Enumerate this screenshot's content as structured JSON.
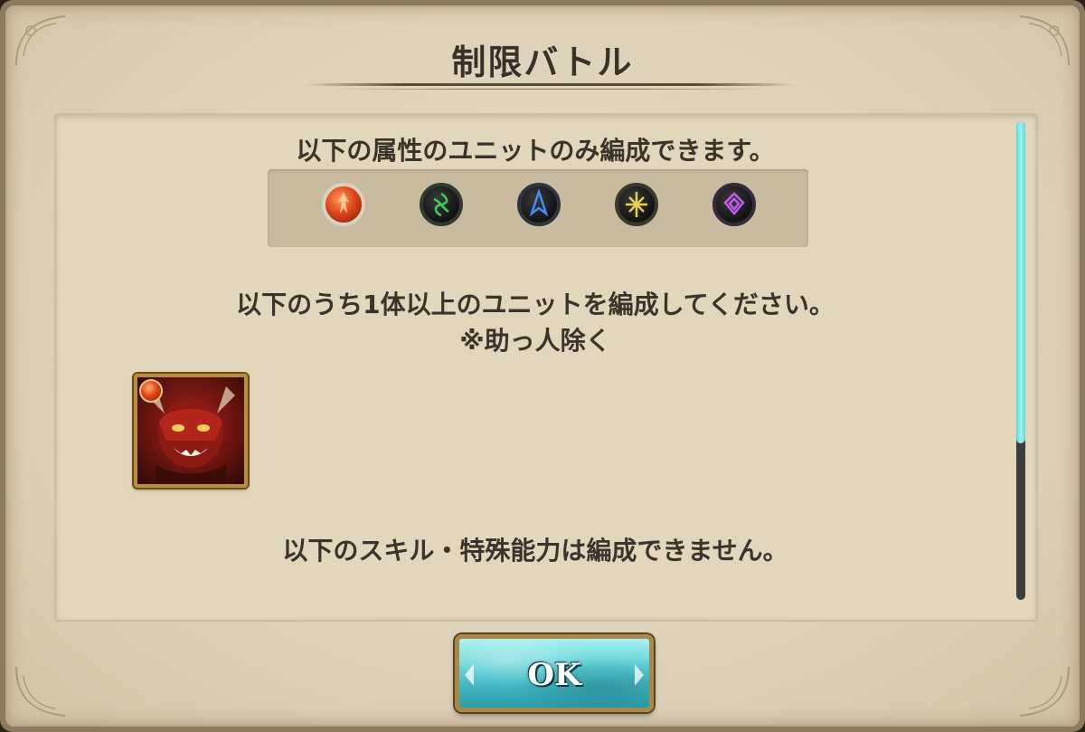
{
  "dialog": {
    "title": "制限バトル",
    "attribute_restriction_text": "以下の属性のユニットのみ編成できます。",
    "attributes": [
      {
        "name": "fire",
        "color": "#e0461a",
        "icon": "fire-attribute-icon"
      },
      {
        "name": "wind",
        "color": "#2a8a3a",
        "icon": "wind-attribute-icon"
      },
      {
        "name": "water",
        "color": "#2f6fd0",
        "icon": "water-attribute-icon"
      },
      {
        "name": "light",
        "color": "#c9b43a",
        "icon": "light-attribute-icon"
      },
      {
        "name": "dark",
        "color": "#8a36b8",
        "icon": "dark-attribute-icon"
      }
    ],
    "unit_requirement_text": "以下のうち1体以上のユニットを編成してください。",
    "unit_requirement_note": "※助っ人除く",
    "required_units": [
      {
        "icon": "red-demon-unit-portrait",
        "attribute": "fire"
      }
    ],
    "skill_restriction_text": "以下のスキル・特殊能力は編成できません。",
    "ok_button": "OK"
  },
  "colors": {
    "accent": "#55cbd3",
    "text": "#3b342b",
    "frame": "#b88e3c"
  }
}
